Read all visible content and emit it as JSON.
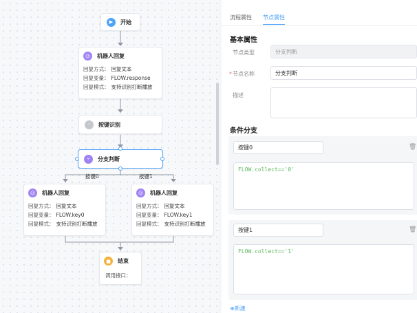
{
  "flow": {
    "start_label": "开始",
    "robot_reply": {
      "title": "机器人回复",
      "rows": [
        {
          "key": "回复方式：",
          "val": "回复文本"
        },
        {
          "key": "回复变量：",
          "val": "FLOW.response"
        },
        {
          "key": "回复模式：",
          "val": "支持识别打断播放"
        }
      ]
    },
    "key_recognition_label": "按键识别",
    "branch_label": "分支判断",
    "branch_left_label": "按键0",
    "branch_right_label": "按键1",
    "reply_left": {
      "title": "机器人回复",
      "rows": [
        {
          "key": "回复方式：",
          "val": "回复文本"
        },
        {
          "key": "回复变量：",
          "val": "FLOW.key0"
        },
        {
          "key": "回复模式：",
          "val": "支持识别打断播放"
        }
      ]
    },
    "reply_right": {
      "title": "机器人回复",
      "rows": [
        {
          "key": "回复方式：",
          "val": "回复文本"
        },
        {
          "key": "回复变量：",
          "val": "FLOW.key1"
        },
        {
          "key": "回复模式：",
          "val": "支持识别打断播放"
        }
      ]
    },
    "end_label": "结束",
    "end_sub": "调用接口："
  },
  "panel": {
    "tabs": [
      {
        "label": "流程属性"
      },
      {
        "label": "节点属性"
      }
    ],
    "basic_title": "基本属性",
    "node_type_label": "节点类型",
    "node_type_value": "分支判断",
    "node_name_label": "节点名称",
    "node_name_value": "分支判断",
    "desc_label": "描述",
    "desc_value": "",
    "cond_title": "条件分支",
    "conditions": [
      {
        "name": "按键0",
        "expr": "FLOW.collect=='0'"
      },
      {
        "name": "按键1",
        "expr": "FLOW.collect=='1'"
      }
    ],
    "add_label": "⊕新建"
  },
  "colors": {
    "accent": "#4ea3f7",
    "robot_icon": "#9f83f4",
    "end_icon": "#f6b13b",
    "code_text": "#5cb85c"
  }
}
